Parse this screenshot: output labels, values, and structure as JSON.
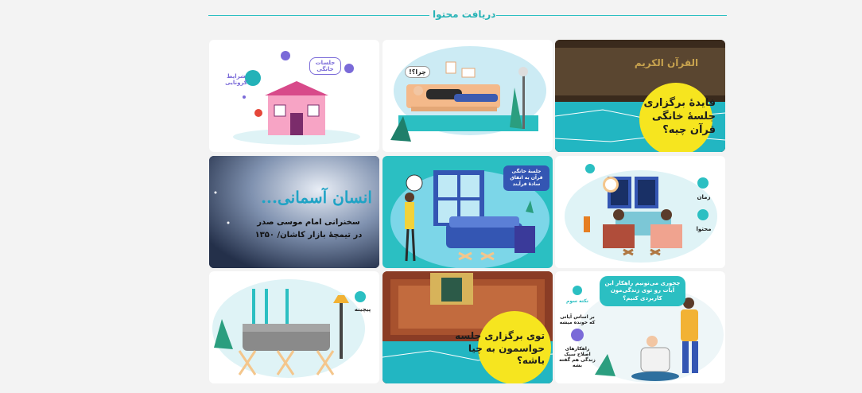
{
  "header": {
    "title": "دریافت محتوا"
  },
  "tiles": {
    "t1": {
      "caption": "فایدهٔ برگزاری جلسهٔ خانگی قرآن چیه؟",
      "book_title": "القرآن الكريم"
    },
    "t2": {
      "bubble": "چرا؟!"
    },
    "t3": {
      "bubble": "جلسات خانگی",
      "side_label": "شرایط کرونایی"
    },
    "t4": {
      "labels": [
        "زمان",
        "محتوا"
      ]
    },
    "t5": {
      "note": "جلسهٔ خانگی قرآن به اتفاق سادهٔ فرآیند"
    },
    "t6": {
      "calligraphy": "انسان آسمانی...",
      "line1": "سخنرانی امام موسی صدر",
      "line2": "در تیمچهٔ بازار کاشان/ ۱۳۵۰"
    },
    "t7": {
      "note": "چجوری می‌تونیم راهکار این آیات رو توی زندگی‌مون کاربردی کنیم؟",
      "side_labels": [
        "نکته سوم",
        "بر اساس آیاتی که خونده میشه",
        "راهکارهای اصلاح سبک زندگی هم گفته بشه"
      ]
    },
    "t8": {
      "caption": "توی برگزاری جلسه حواسمون به چیا باشه؟"
    },
    "t9": {
      "side_label": "پیچینه"
    }
  },
  "colors": {
    "accent": "#2bbfc2",
    "yellow": "#f6e51f",
    "dark": "#1d1d1d"
  }
}
